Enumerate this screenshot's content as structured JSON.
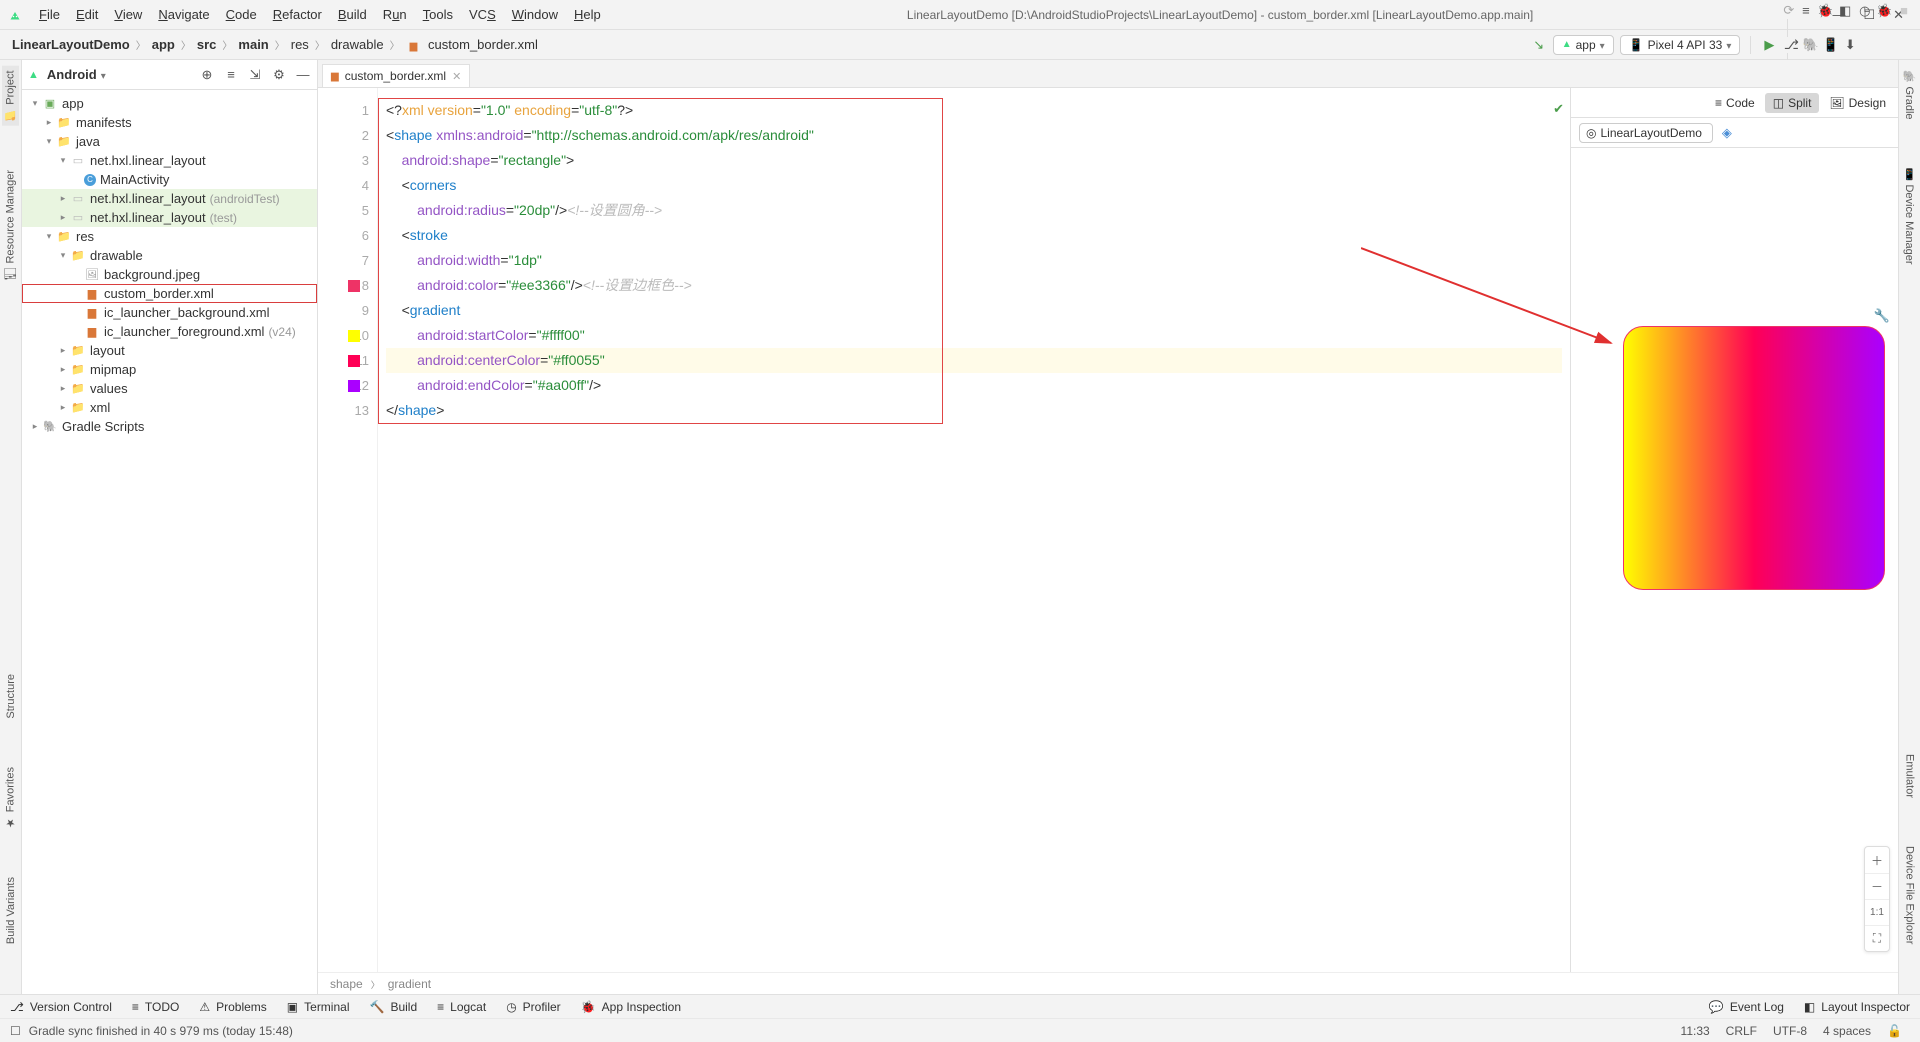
{
  "window": {
    "title": "LinearLayoutDemo [D:\\AndroidStudioProjects\\LinearLayoutDemo] - custom_border.xml [LinearLayoutDemo.app.main]"
  },
  "menu": [
    "File",
    "Edit",
    "View",
    "Navigate",
    "Code",
    "Refactor",
    "Build",
    "Run",
    "Tools",
    "VCS",
    "Window",
    "Help"
  ],
  "crumbs": [
    "LinearLayoutDemo",
    "app",
    "src",
    "main",
    "res",
    "drawable",
    "custom_border.xml"
  ],
  "run_config": {
    "label": "app"
  },
  "device": {
    "label": "Pixel 4 API 33"
  },
  "project_view": "Android",
  "tree": [
    {
      "d": 0,
      "exp": "v",
      "ic": "app",
      "txt": "app"
    },
    {
      "d": 1,
      "exp": ">",
      "ic": "folder",
      "txt": "manifests"
    },
    {
      "d": 1,
      "exp": "v",
      "ic": "folder",
      "txt": "java"
    },
    {
      "d": 2,
      "exp": "v",
      "ic": "pkg",
      "txt": "net.hxl.linear_layout"
    },
    {
      "d": 3,
      "exp": "",
      "ic": "cls",
      "txt": "MainActivity"
    },
    {
      "d": 2,
      "exp": ">",
      "ic": "pkg",
      "txt": "net.hxl.linear_layout",
      "annot": "(androidTest)",
      "hl": true
    },
    {
      "d": 2,
      "exp": ">",
      "ic": "pkg",
      "txt": "net.hxl.linear_layout",
      "annot": "(test)",
      "hl": true
    },
    {
      "d": 1,
      "exp": "v",
      "ic": "folder",
      "txt": "res"
    },
    {
      "d": 2,
      "exp": "v",
      "ic": "folder",
      "txt": "drawable"
    },
    {
      "d": 3,
      "exp": "",
      "ic": "file",
      "txt": "background.jpeg"
    },
    {
      "d": 3,
      "exp": "",
      "ic": "xml",
      "txt": "custom_border.xml",
      "boxed": true
    },
    {
      "d": 3,
      "exp": "",
      "ic": "xml",
      "txt": "ic_launcher_background.xml"
    },
    {
      "d": 3,
      "exp": "",
      "ic": "xml",
      "txt": "ic_launcher_foreground.xml",
      "annot": "(v24)"
    },
    {
      "d": 2,
      "exp": ">",
      "ic": "folder",
      "txt": "layout"
    },
    {
      "d": 2,
      "exp": ">",
      "ic": "folder",
      "txt": "mipmap"
    },
    {
      "d": 2,
      "exp": ">",
      "ic": "folder",
      "txt": "values"
    },
    {
      "d": 2,
      "exp": ">",
      "ic": "folder",
      "txt": "xml"
    },
    {
      "d": 0,
      "exp": ">",
      "ic": "script",
      "txt": "Gradle Scripts"
    }
  ],
  "tab": {
    "label": "custom_border.xml"
  },
  "gutter_swatches": {
    "8": "#ee3366",
    "10": "#ffff00",
    "11": "#ff0055",
    "12": "#aa00ff"
  },
  "code": {
    "l1": {
      "a": "<?",
      "b": "xml version",
      "c": "=",
      "d": "\"1.0\"",
      "e": " encoding",
      "f": "=",
      "g": "\"utf-8\"",
      "h": "?>"
    },
    "l2": {
      "a": "<",
      "b": "shape",
      "c": " xmlns:",
      "d": "android",
      "e": "=",
      "f": "\"http://schemas.android.com/apk/res/android\""
    },
    "l3": {
      "a": "android:",
      "b": "shape",
      "c": "=",
      "d": "\"rectangle\"",
      "e": ">"
    },
    "l4": {
      "a": "<",
      "b": "corners"
    },
    "l5": {
      "a": "android:",
      "b": "radius",
      "c": "=",
      "d": "\"20dp\"",
      "e": "/>",
      "cmt": "<!--设置圆角-->"
    },
    "l6": {
      "a": "<",
      "b": "stroke"
    },
    "l7": {
      "a": "android:",
      "b": "width",
      "c": "=",
      "d": "\"1dp\""
    },
    "l8": {
      "a": "android:",
      "b": "color",
      "c": "=",
      "d": "\"#ee3366\"",
      "e": "/>",
      "cmt": "<!--设置边框色-->"
    },
    "l9": {
      "a": "<",
      "b": "gradient"
    },
    "l10": {
      "a": "android:",
      "b": "startColor",
      "c": "=",
      "d": "\"#ffff00\""
    },
    "l11": {
      "a": "android:",
      "b": "centerColor",
      "c": "=",
      "d": "\"#ff0055\""
    },
    "l12": {
      "a": "android:",
      "b": "endColor",
      "c": "=",
      "d": "\"#aa00ff\"",
      "e": "/>"
    },
    "l13": {
      "a": "</",
      "b": "shape",
      "c": ">"
    }
  },
  "modes": {
    "code": "Code",
    "split": "Split",
    "design": "Design"
  },
  "preview_device": "LinearLayoutDemo",
  "breadcrumb2": [
    "shape",
    "gradient"
  ],
  "bottom_tools": [
    "Version Control",
    "TODO",
    "Problems",
    "Terminal",
    "Build",
    "Logcat",
    "Profiler",
    "App Inspection"
  ],
  "bottom_right": [
    "Event Log",
    "Layout Inspector"
  ],
  "status": {
    "msg": "Gradle sync finished in 40 s 979 ms (today 15:48)",
    "pos": "11:33",
    "eol": "CRLF",
    "enc": "UTF-8",
    "indent": "4 spaces"
  },
  "left_tabs": [
    "Project",
    "Resource Manager"
  ],
  "left_tabs2": [
    "Build Variants",
    "Favorites",
    "Structure"
  ],
  "right_tabs": [
    "Gradle",
    "Device Manager"
  ],
  "right_tabs2": [
    "Emulator",
    "Device File Explorer"
  ]
}
